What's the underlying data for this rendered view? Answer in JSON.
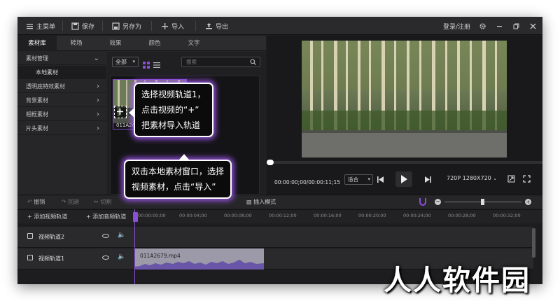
{
  "toolbar": {
    "main_menu": "主菜单",
    "save": "保存",
    "save_as": "另存为",
    "import": "导入",
    "export": "导出",
    "login": "登录/注册"
  },
  "tabs": [
    "素材库",
    "转场",
    "效果",
    "颜色",
    "文字"
  ],
  "sidebar": {
    "items": [
      {
        "label": "素材管理"
      },
      {
        "label": "本地素材"
      },
      {
        "label": "透明底特效素材"
      },
      {
        "label": "背景素材"
      },
      {
        "label": "相框素材"
      },
      {
        "label": "片头素材"
      }
    ]
  },
  "library": {
    "filter_value": "全部",
    "search_placeholder": "搜索",
    "thumb_label": "011A26"
  },
  "preview": {
    "timecode": "00:00:00;00/00:00:11;15",
    "fit_label": "适合",
    "resolution": "720P 1280X720"
  },
  "timeline_tools": {
    "undo": "撤销",
    "redo": "回退",
    "cut": "切割",
    "insert_mode": "插入模式",
    "add_video_track": "添加视频轨道",
    "add_audio_track": "添加音频轨道"
  },
  "ruler": [
    "00:00:00;00",
    "00:00:04;00",
    "00:00:08;00",
    "00:00:12;00",
    "00:00:16;00",
    "00:00:20;00",
    "00:00:24;00",
    "00:00:28;00",
    "00:00:32;00"
  ],
  "tracks": {
    "track2": "视频轨道2",
    "track1": "视频轨道1",
    "clip_name": "011A2679.mp4"
  },
  "callouts": {
    "top": [
      "选择视频轨道1，",
      "点击视频的“+”",
      "把素材导入轨道"
    ],
    "bottom": [
      "双击本地素材窗口，选择",
      "视频素材，点击“导入”"
    ]
  },
  "watermark": "人人软件园",
  "colors": {
    "accent": "#8a4fd8",
    "callout_glow": "#aa5aff",
    "background": "#1e1e20"
  }
}
